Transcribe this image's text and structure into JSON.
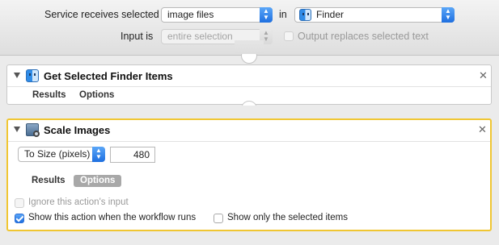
{
  "service_header": {
    "receives_label": "Service receives selected",
    "receives_value": "image files",
    "in_label": "in",
    "app_value": "Finder",
    "input_is_label": "Input is",
    "input_value": "entire selection",
    "output_replaces_label": "Output replaces selected text",
    "output_replaces_checked": false
  },
  "actions": [
    {
      "title": "Get Selected Finder Items",
      "icon": "finder-icon",
      "results_label": "Results",
      "options_label": "Options"
    },
    {
      "title": "Scale Images",
      "icon": "preview-icon",
      "scale_mode": "To Size (pixels)",
      "size_value": "480",
      "results_label": "Results",
      "options_label": "Options",
      "ignore_input_label": "Ignore this action's input",
      "ignore_input_checked": false,
      "show_when_runs_label": "Show this action when the workflow runs",
      "show_when_runs_checked": true,
      "show_selected_label": "Show only the selected items",
      "show_selected_checked": false,
      "highlight_color": "#f0c632"
    }
  ],
  "colors": {
    "accent": "#1e6fe0",
    "selected_border": "#f0c632"
  }
}
